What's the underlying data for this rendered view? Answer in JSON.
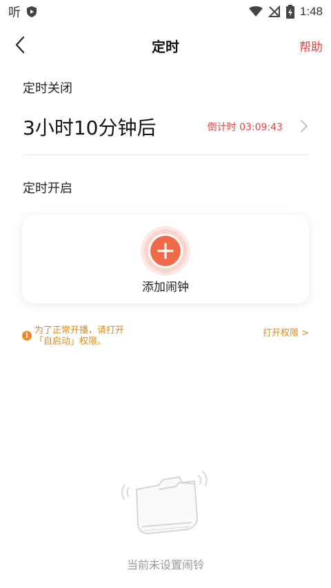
{
  "status_bar": {
    "app_char": "听",
    "time": "1:48",
    "icons": [
      "app-icon",
      "shield-icon",
      "wifi-icon",
      "signal-off-icon",
      "battery-charging-icon"
    ]
  },
  "header": {
    "title": "定时",
    "help": "帮助",
    "back_icon": "chevron-left-icon"
  },
  "timer_off": {
    "section_title": "定时关闭",
    "value": "3小时10分钟后",
    "countdown": "倒计时 03:09:43",
    "chevron_icon": "chevron-right-icon"
  },
  "timer_on": {
    "section_title": "定时开启",
    "add_label": "添加闹钟",
    "add_icon": "plus-icon"
  },
  "notice": {
    "line1": "为了正常开播，请打开",
    "line2": "「自启动」权限。",
    "link": "打开权限 >",
    "icon": "info-icon"
  },
  "empty": {
    "text": "当前未设置闹铃",
    "icon": "empty-folder-icon"
  },
  "colors": {
    "accent": "#e8413e",
    "warning": "#e08a12",
    "add_button": "#f06a4a"
  }
}
